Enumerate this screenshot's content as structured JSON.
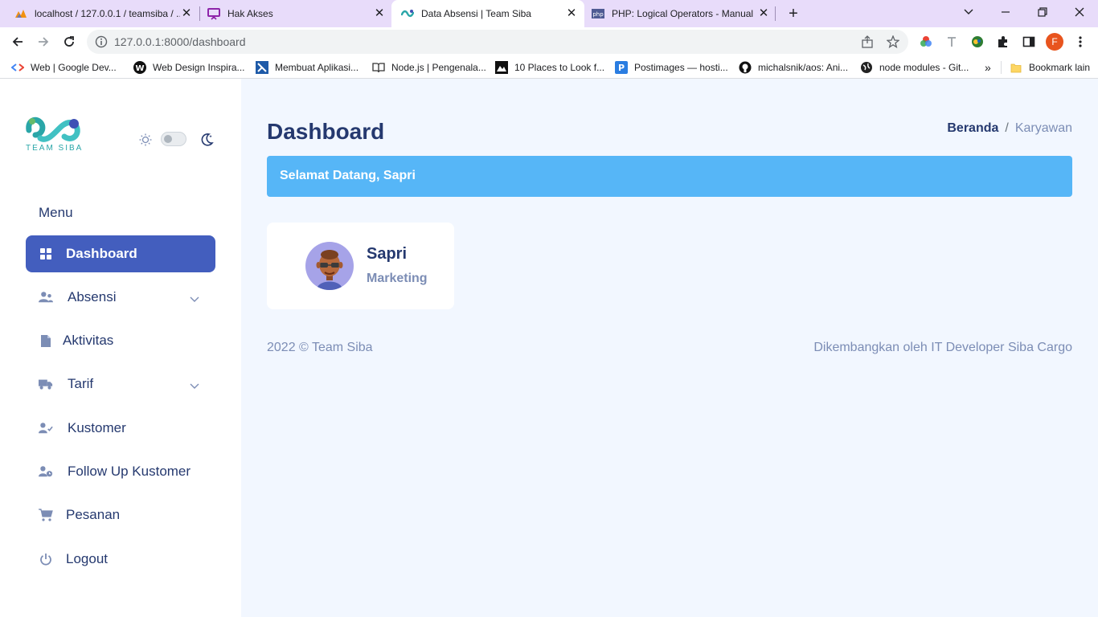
{
  "browser": {
    "tabs": [
      {
        "title": "localhost / 127.0.0.1 / teamsiba / ...",
        "icon": "phpmyadmin-icon",
        "active": false
      },
      {
        "title": "Hak Akses",
        "icon": "presentation-icon",
        "active": false
      },
      {
        "title": "Data Absensi | Team Siba",
        "icon": "team-siba-icon",
        "active": true
      },
      {
        "title": "PHP: Logical Operators - Manual",
        "icon": "php-icon",
        "active": false
      }
    ],
    "url": "127.0.0.1:8000/dashboard",
    "profile_initial": "F",
    "bookmarks": [
      {
        "label": "Web | Google Dev...",
        "icon": "google-dev-icon"
      },
      {
        "label": "Web Design Inspira...",
        "icon": "w-logo-icon"
      },
      {
        "label": "Membuat Aplikasi...",
        "icon": "app-icon"
      },
      {
        "label": "Node.js | Pengenala...",
        "icon": "book-icon"
      },
      {
        "label": "10 Places to Look f...",
        "icon": "mountain-icon"
      },
      {
        "label": "Postimages — hosti...",
        "icon": "postimages-icon"
      },
      {
        "label": "michalsnik/aos: Ani...",
        "icon": "github-icon"
      },
      {
        "label": "node modules - Git...",
        "icon": "globe-icon"
      }
    ],
    "bookmarks_more": "»",
    "other_bookmarks": "Bookmark lain"
  },
  "sidebar": {
    "logo_text": "TEAM SIBA",
    "menu_title": "Menu",
    "items": [
      {
        "label": "Dashboard",
        "icon": "grid-icon",
        "active": true,
        "has_submenu": false
      },
      {
        "label": "Absensi",
        "icon": "user-group-icon",
        "active": false,
        "has_submenu": true
      },
      {
        "label": "Aktivitas",
        "icon": "file-icon",
        "active": false,
        "has_submenu": false
      },
      {
        "label": "Tarif",
        "icon": "truck-icon",
        "active": false,
        "has_submenu": true
      },
      {
        "label": "Kustomer",
        "icon": "user-check-icon",
        "active": false,
        "has_submenu": false
      },
      {
        "label": "Follow Up Kustomer",
        "icon": "user-clock-icon",
        "active": false,
        "has_submenu": false
      },
      {
        "label": "Pesanan",
        "icon": "cart-icon",
        "active": false,
        "has_submenu": false
      },
      {
        "label": "Logout",
        "icon": "power-icon",
        "active": false,
        "has_submenu": false
      }
    ]
  },
  "main": {
    "title": "Dashboard",
    "breadcrumb": {
      "home": "Beranda",
      "separator": "/",
      "current": "Karyawan"
    },
    "welcome": "Selamat Datang, Sapri",
    "user": {
      "name": "Sapri",
      "role": "Marketing"
    },
    "footer_left": "2022 © Team Siba",
    "footer_right": "Dikembangkan oleh IT Developer Siba Cargo"
  },
  "colors": {
    "accent": "#435ebe",
    "alert": "#56b6f7",
    "heading": "#25396f",
    "muted": "#7c8db5",
    "main_bg": "#f2f7ff",
    "tabstrip": "#e8dcfa"
  }
}
